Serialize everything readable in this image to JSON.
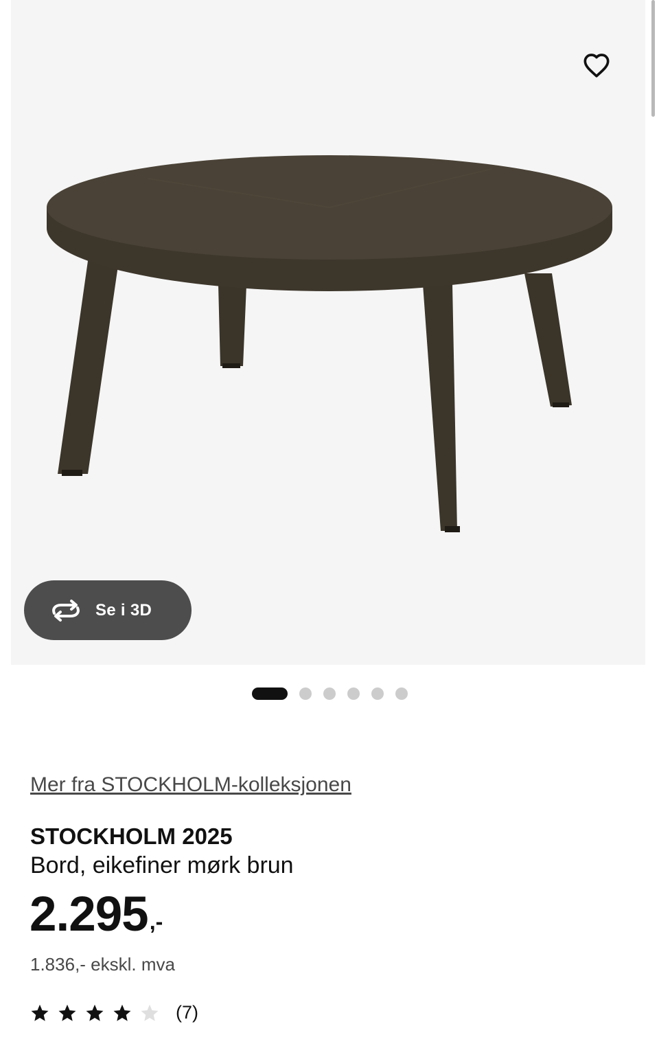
{
  "gallery": {
    "favorite_icon": "heart-outline-icon",
    "view_3d_label": "Se i 3D",
    "view_3d_icon": "rotate-3d-icon",
    "slide_count": 6,
    "active_slide": 1
  },
  "product": {
    "collection_link": "Mer fra STOCKHOLM-kolleksjonen",
    "name": "STOCKHOLM 2025",
    "description": "Bord, eikefiner mørk brun",
    "price": "2.295",
    "price_suffix": ",-",
    "price_ex_vat": "1.836,- ekskl. mva",
    "rating": 4,
    "rating_max": 5,
    "review_count": "(7)"
  },
  "colors": {
    "star_filled": "#111111",
    "star_empty": "#dfdfdf",
    "button_3d_bg": "#4d4d4d",
    "dot_active": "#111111",
    "dot_inactive": "#cccccc"
  }
}
